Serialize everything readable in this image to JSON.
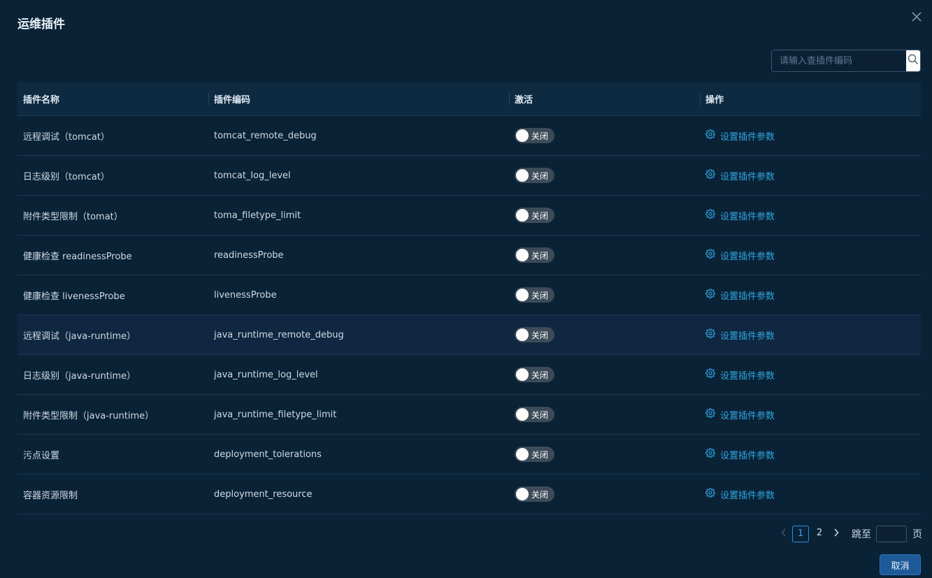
{
  "dialog": {
    "title": "运维插件",
    "close_icon": "close-icon"
  },
  "search": {
    "placeholder": "请输入查插件编码",
    "value": "",
    "icon": "search-icon"
  },
  "table": {
    "columns": [
      "插件名称",
      "插件编码",
      "激活",
      "操作"
    ],
    "rows": [
      {
        "name": "远程调试（tomcat）",
        "code": "tomcat_remote_debug",
        "status": "关闭",
        "action": "设置插件参数"
      },
      {
        "name": "日志级别（tomcat）",
        "code": "tomcat_log_level",
        "status": "关闭",
        "action": "设置插件参数"
      },
      {
        "name": "附件类型限制（tomat）",
        "code": "toma_filetype_limit",
        "status": "关闭",
        "action": "设置插件参数"
      },
      {
        "name": "健康检查 readinessProbe",
        "code": "readinessProbe",
        "status": "关闭",
        "action": "设置插件参数"
      },
      {
        "name": "健康检查 livenessProbe",
        "code": "livenessProbe",
        "status": "关闭",
        "action": "设置插件参数"
      },
      {
        "name": "远程调试（java-runtime）",
        "code": "java_runtime_remote_debug",
        "status": "关闭",
        "action": "设置插件参数"
      },
      {
        "name": "日志级别（java-runtime）",
        "code": "java_runtime_log_level",
        "status": "关闭",
        "action": "设置插件参数"
      },
      {
        "name": "附件类型限制（java-runtime）",
        "code": "java_runtime_filetype_limit",
        "status": "关闭",
        "action": "设置插件参数"
      },
      {
        "name": "污点设置",
        "code": "deployment_tolerations",
        "status": "关闭",
        "action": "设置插件参数"
      },
      {
        "name": "容器资源限制",
        "code": "deployment_resource",
        "status": "关闭",
        "action": "设置插件参数"
      }
    ]
  },
  "pagination": {
    "pages": [
      "1",
      "2"
    ],
    "current": "1",
    "jump_label": "跳至",
    "jump_value": "",
    "page_unit": "页"
  },
  "footer": {
    "cancel_label": "取消"
  },
  "colors": {
    "background": "#0a2236",
    "accent": "#2fa6e0",
    "primary_button": "#1e5a98",
    "toggle_off": "#3d4b59"
  }
}
